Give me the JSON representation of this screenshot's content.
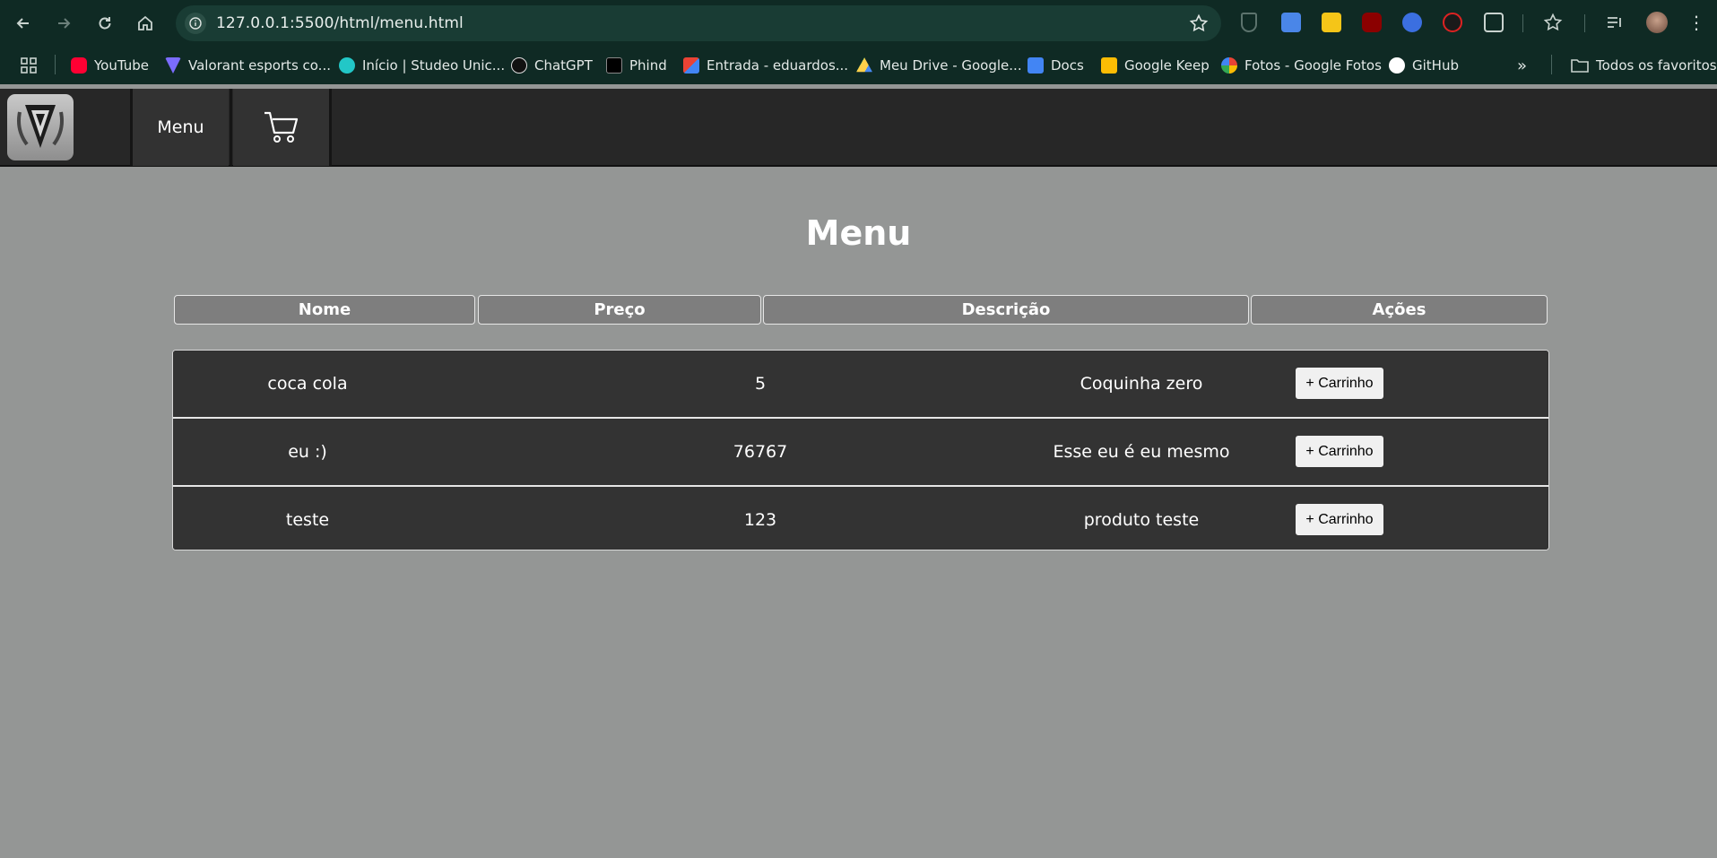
{
  "browser": {
    "url": "127.0.0.1:5500/html/menu.html",
    "bookmarks": [
      {
        "label": "YouTube",
        "icon": "youtube-icon",
        "color": "#ff0033"
      },
      {
        "label": "Valorant esports co...",
        "icon": "valorant-icon",
        "color": "#7b6cff"
      },
      {
        "label": "Início | Studeo Unic...",
        "icon": "studeo-icon",
        "color": "#22c7c7"
      },
      {
        "label": "ChatGPT",
        "icon": "chatgpt-icon",
        "color": "#111111"
      },
      {
        "label": "Phind",
        "icon": "phind-icon",
        "color": "#000000"
      },
      {
        "label": "Entrada - eduardos...",
        "icon": "gmail-icon",
        "color": "#ea4335"
      },
      {
        "label": "Meu Drive - Google...",
        "icon": "google-drive-icon",
        "color": "#1fa463"
      },
      {
        "label": "Docs",
        "icon": "google-docs-icon",
        "color": "#4285f4"
      },
      {
        "label": "Google Keep",
        "icon": "google-keep-icon",
        "color": "#fbbc04"
      },
      {
        "label": "Fotos - Google Fotos",
        "icon": "google-photos-icon",
        "color": "#ea4335"
      },
      {
        "label": "GitHub",
        "icon": "github-icon",
        "color": "#ffffff"
      }
    ],
    "all_bookmarks_label": "Todos os favoritos"
  },
  "header": {
    "logo_icon": "valorant-logo-icon",
    "menu_label": "Menu",
    "cart_icon": "shopping-cart-icon"
  },
  "main": {
    "title": "Menu",
    "columns": [
      "Nome",
      "Preço",
      "Descrição",
      "Ações"
    ],
    "rows": [
      {
        "nome": "coca cola",
        "preco": "5",
        "descricao": "Coquinha zero",
        "acao": "+ Carrinho"
      },
      {
        "nome": "eu :)",
        "preco": "76767",
        "descricao": "Esse eu é eu mesmo",
        "acao": "+ Carrinho"
      },
      {
        "nome": "teste",
        "preco": "123",
        "descricao": "produto teste",
        "acao": "+ Carrinho"
      }
    ]
  },
  "colors": {
    "page_background": "#949695",
    "header_background": "#272727",
    "row_background": "#333333",
    "table_header_background": "#7e7e7e",
    "browser_chrome": "#0f2a24"
  }
}
